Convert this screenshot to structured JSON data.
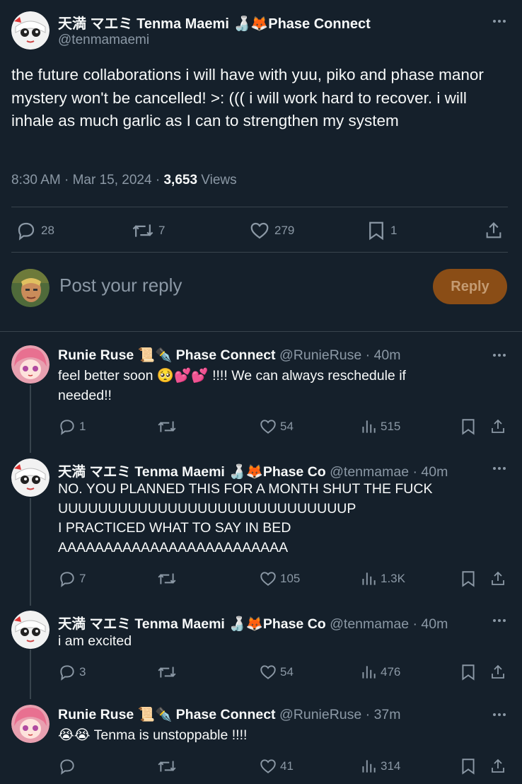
{
  "main_tweet": {
    "display_name": "天満 マエミ Tenma Maemi 🍶🦊Phase Connect",
    "handle": "@tenmamaemi",
    "text": "the future collaborations i will have with yuu, piko and phase manor mystery won't be cancelled! >: ((( i will work hard to recover. i will inhale as much garlic as I can to strengthen my system",
    "time": "8:30 AM",
    "date": "Mar 15, 2024",
    "views_count": "3,653",
    "views_label": "Views",
    "replies": "28",
    "reposts": "7",
    "likes": "279",
    "bookmarks": "1"
  },
  "reply_box": {
    "placeholder": "Post your reply",
    "button": "Reply"
  },
  "replies": [
    {
      "display_name": "Runie Ruse 📜✒️ Phase Connect",
      "handle": "@RunieRuse",
      "time": "· 40m",
      "lines": [
        "feel better soon 🥺💕💕 !!!! We can always reschedule if",
        "needed!!"
      ],
      "replies": "1",
      "reposts": "",
      "likes": "54",
      "views": "515"
    },
    {
      "display_name": "天満 マエミ Tenma Maemi 🍶🦊Phase Co",
      "handle": "@tenmamae",
      "time": "· 40m",
      "lines": [
        "NO. YOU PLANNED THIS FOR A MONTH SHUT THE FUCK",
        "UUUUUUUUUUUUUUUUUUUUUUUUUUUUUP",
        "I PRACTICED WHAT TO SAY IN BED",
        "AAAAAAAAAAAAAAAAAAAAAAAAA"
      ],
      "replies": "7",
      "reposts": "",
      "likes": "105",
      "views": "1.3K"
    },
    {
      "display_name": "天満 マエミ Tenma Maemi 🍶🦊Phase Co",
      "handle": "@tenmamae",
      "time": "· 40m",
      "lines": [
        "i am excited"
      ],
      "replies": "3",
      "reposts": "",
      "likes": "54",
      "views": "476"
    },
    {
      "display_name": "Runie Ruse 📜✒️ Phase Connect",
      "handle": "@RunieRuse",
      "time": "· 37m",
      "lines": [
        "😭😭 Tenma is unstoppable !!!!"
      ],
      "replies": "",
      "reposts": "",
      "likes": "41",
      "views": "314"
    }
  ],
  "icons": {
    "more": "more-icon",
    "reply": "reply-icon",
    "repost": "repost-icon",
    "like": "like-icon",
    "bookmark": "bookmark-icon",
    "share": "share-icon",
    "views": "views-icon"
  },
  "colors": {
    "background": "#15202b",
    "text": "#f7f9f9",
    "muted": "#8b98a5",
    "border": "#38444d",
    "reply_button": "#8a4d16"
  }
}
